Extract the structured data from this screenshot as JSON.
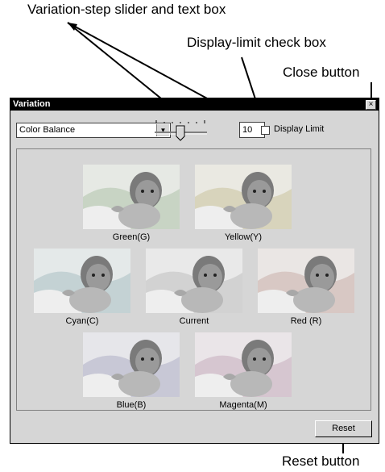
{
  "callouts": {
    "variation_step": "Variation-step slider and text box",
    "display_limit": "Display-limit check box",
    "close": "Close button",
    "reset": "Reset button"
  },
  "window": {
    "title": "Variation",
    "close_glyph": "×",
    "mode_select": {
      "value": "Color Balance"
    },
    "step_value": "10",
    "display_limit_label": "Display Limit",
    "display_limit_checked": false,
    "reset_label": "Reset"
  },
  "variations": [
    {
      "label": "Green(G)"
    },
    {
      "label": "Yellow(Y)"
    },
    {
      "label": "Cyan(C)"
    },
    {
      "label": "Current"
    },
    {
      "label": "Red (R)"
    },
    {
      "label": "Blue(B)"
    },
    {
      "label": "Magenta(M)"
    }
  ]
}
